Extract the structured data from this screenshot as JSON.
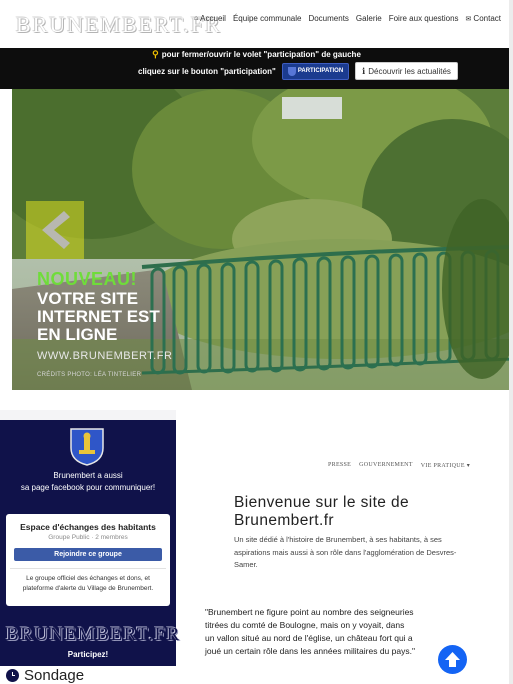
{
  "header": {
    "logo_text": "BRUNEMBERT.FR",
    "nav": [
      {
        "label": "Accueil",
        "icon": "home-icon"
      },
      {
        "label": "Équipe communale",
        "icon": ""
      },
      {
        "label": "Documents",
        "icon": ""
      },
      {
        "label": "Galerie",
        "icon": ""
      },
      {
        "label": "Foire aux questions",
        "icon": ""
      },
      {
        "label": "Contact",
        "icon": "envelope-icon"
      }
    ]
  },
  "banner": {
    "line1": "pour fermer/ouvrir le volet \"participation\" de gauche",
    "line2_prefix": "cliquez sur le bouton \"participation\"",
    "participation_button": "PARTICIPATION",
    "discover_button": "Découvrir les actualités",
    "colors": {
      "background": "#0d0d0d",
      "pin": "#f2c200",
      "participation": "#1b3b8f"
    }
  },
  "hero": {
    "nouveau": "NOUVEAU!",
    "headline_lines": [
      "VOTRE SITE",
      "INTERNET EST",
      "EN LIGNE"
    ],
    "url": "WWW.BRUNEMBERT.FR",
    "credit": "CRÉDITS PHOTO: LÉA TINTELIER",
    "accent_color": "#6fdc3a"
  },
  "sidebar": {
    "text_line1": "Brunembert a aussi",
    "text_line2": "sa page facebook pour communiquer!",
    "facebook_card": {
      "title": "Espace d'échanges des habitants",
      "subtitle": "Groupe Public · 2 membres",
      "join_button": "Rejoindre ce groupe",
      "description": "Le groupe officiel des échanges et dons, et plateforme d'alerte du Village de Brunembert."
    },
    "logo_text": "BRUNEMBERT.FR",
    "participez": "Participez!",
    "sondage": "Sondage",
    "background": "#10124a"
  },
  "content": {
    "subnav": [
      "PRESSE",
      "GOUVERNEMENT",
      "VIE PRATIQUE"
    ],
    "welcome_title": "Bienvenue sur le site de Brunembert.fr",
    "intro": "Un site dédié à l'histoire de Brunembert, à ses habitants, à ses aspirations mais aussi à son rôle dans l'agglomération de Desvres-Samer.",
    "quote": "\"Brunembert ne figure point au nombre des seigneuries titrées du comté de Boulogne, mais on y voyait, dans un vallon situé au nord de l'église, un château fort qui a joué un certain rôle dans les années militaires du pays.\""
  },
  "scroll_top_color": "#1464f4"
}
